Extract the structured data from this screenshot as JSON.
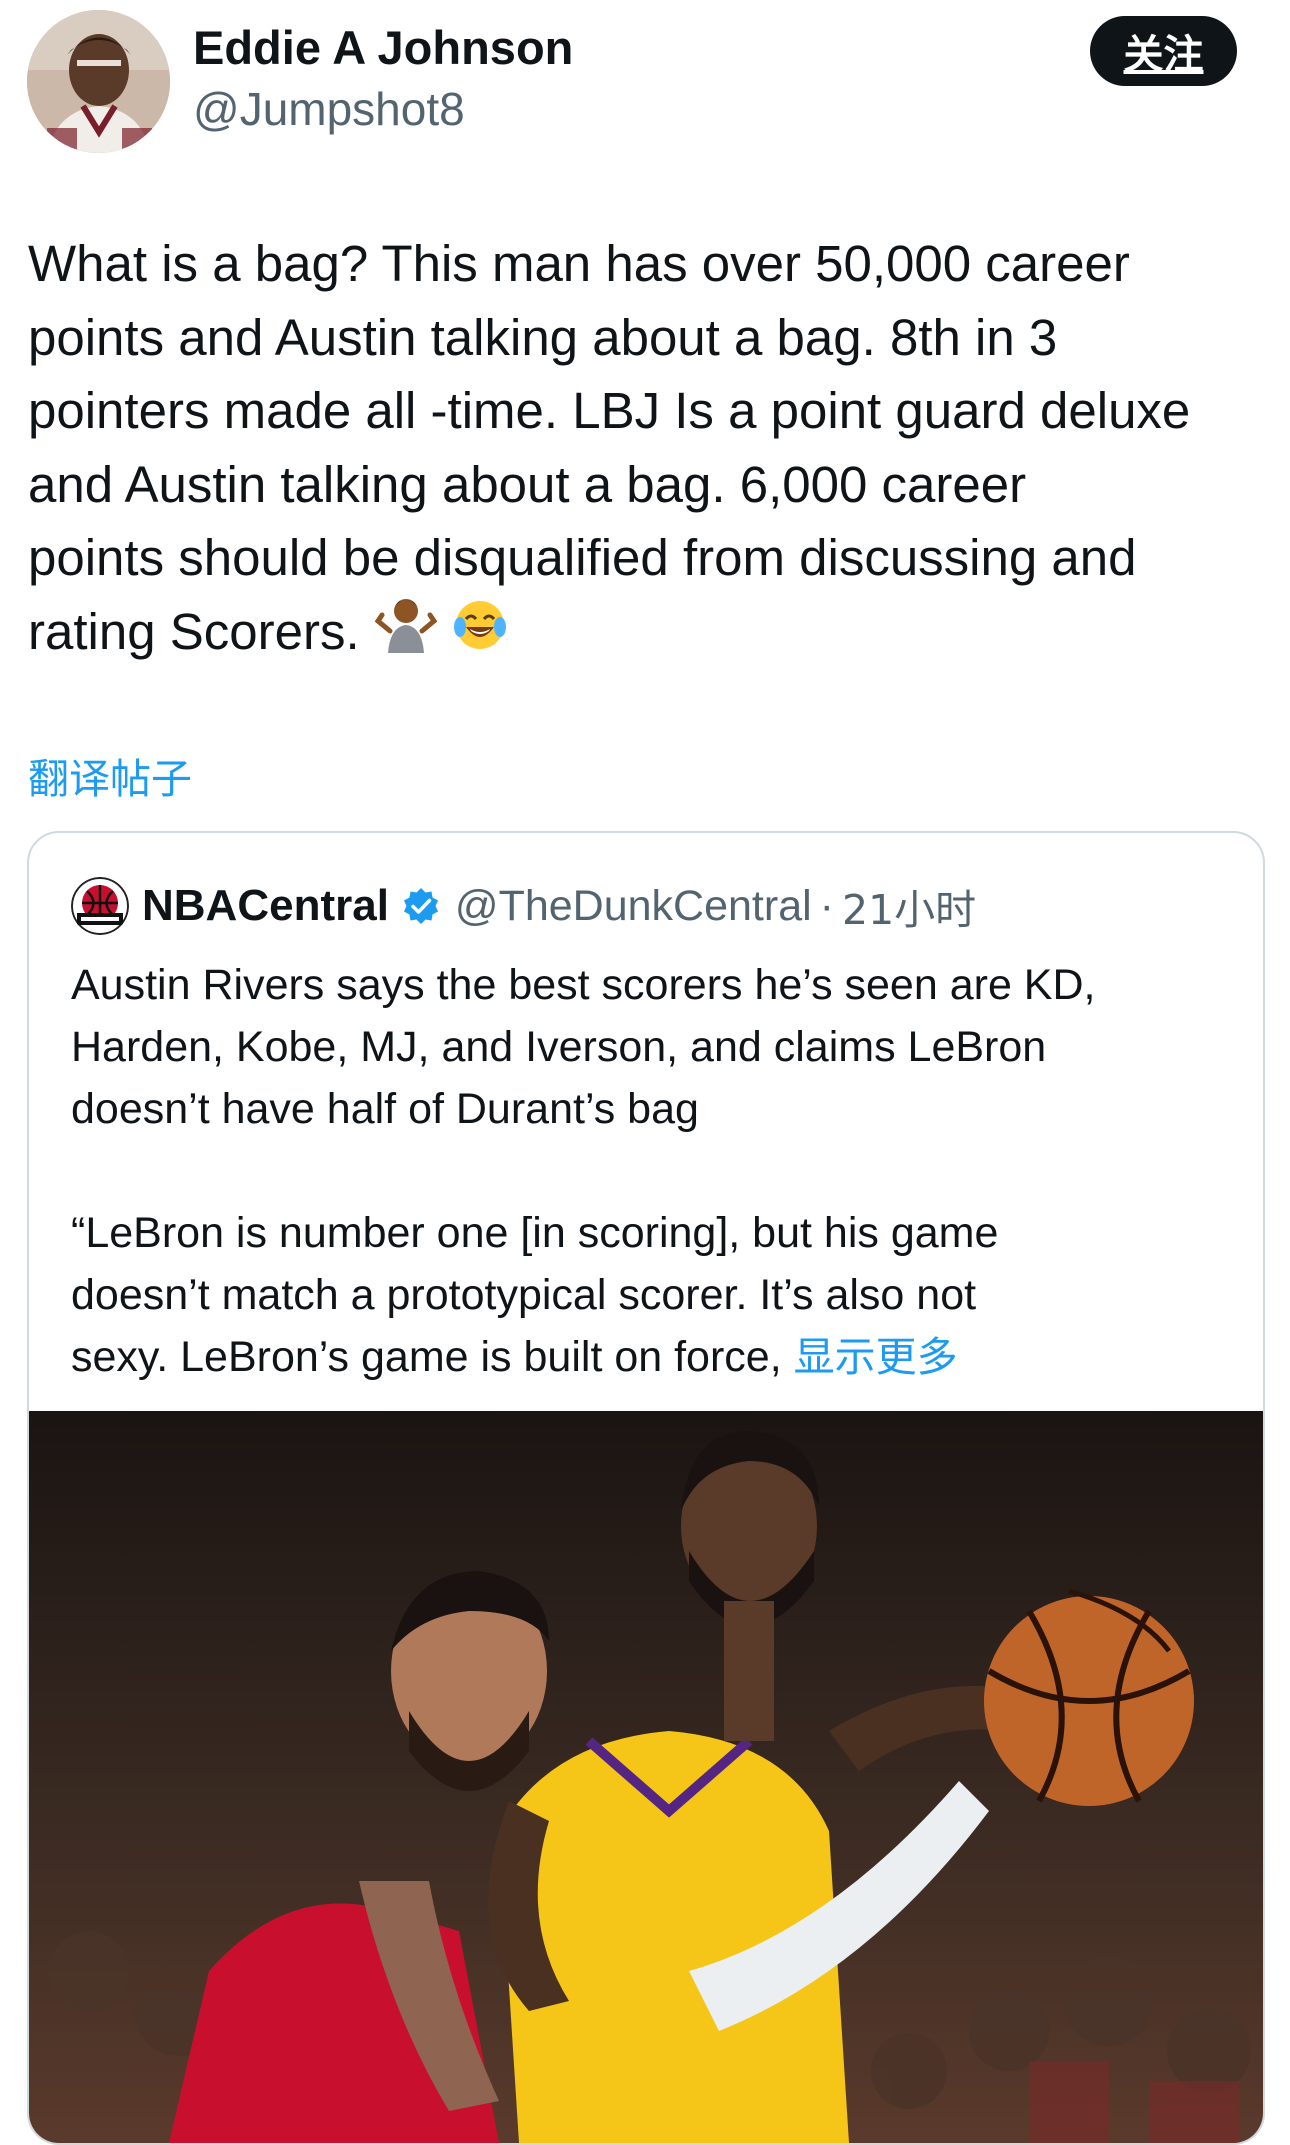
{
  "author": {
    "display_name": "Eddie A Johnson",
    "handle": "@Jumpshot8",
    "avatar_icon": "user-avatar-photo"
  },
  "follow_button": {
    "label": "关注"
  },
  "tweet": {
    "lines": [
      "What is a bag?  This man has over 50,000 career",
      "points and Austin talking about a bag. 8th in 3",
      "pointers made all -time. LBJ Is a point guard deluxe",
      "and Austin talking about a bag.  6,000 career",
      "points should be disqualified from discussing and",
      "rating Scorers."
    ],
    "emojis": [
      "person-shrugging-emoji",
      "tears-of-joy-emoji"
    ]
  },
  "translate_link": "翻译帖子",
  "quote": {
    "display_name": "NBACentral",
    "verified": true,
    "handle": "@TheDunkCentral",
    "separator": "·",
    "time": "21小时",
    "paragraph1": [
      "Austin Rivers says the best scorers he’s seen are KD,",
      "Harden, Kobe, MJ, and Iverson, and claims LeBron",
      "doesn’t have half of Durant’s bag"
    ],
    "paragraph2": [
      "“LeBron is number one [in scoring], but his game",
      "doesn’t match a prototypical scorer. It’s also not",
      "sexy. LeBron’s game is built on force,"
    ],
    "show_more": "显示更多",
    "photo_icon": "basketball-game-photo"
  },
  "colors": {
    "text": "#0f1419",
    "secondary": "#536471",
    "link": "#1d9bf0",
    "border": "#cfd9de",
    "button_bg": "#0f1419"
  }
}
